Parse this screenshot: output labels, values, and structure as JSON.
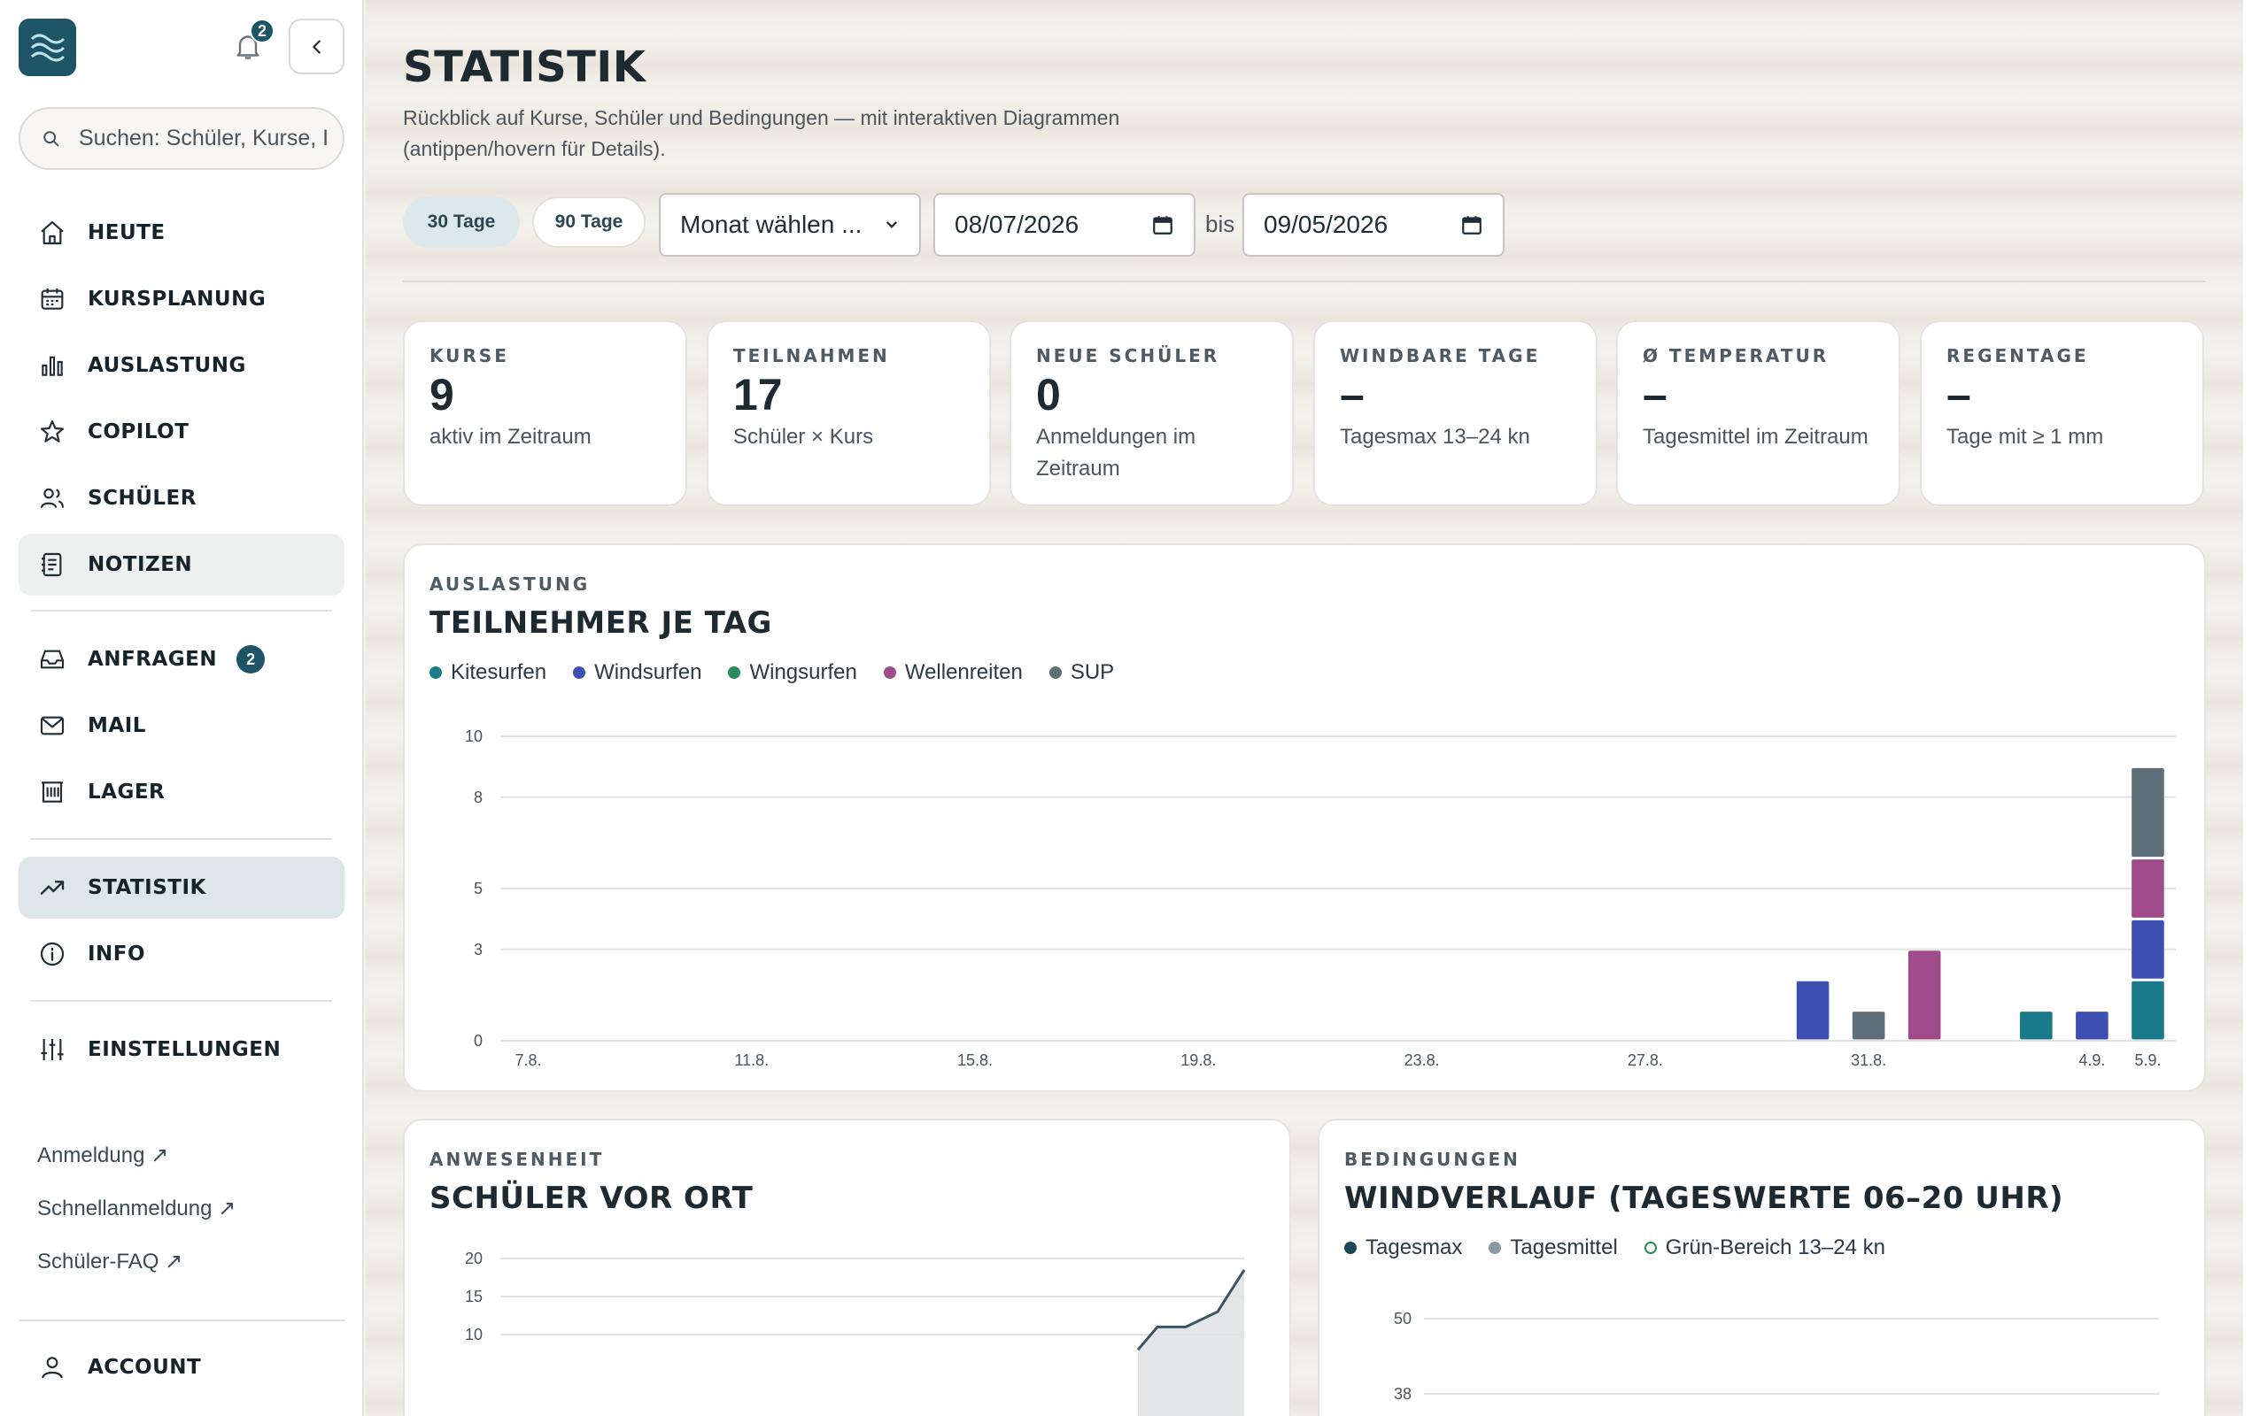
{
  "sidebar": {
    "notification_count": "2",
    "search_placeholder": "Suchen: Schüler, Kurse, I",
    "nav": [
      {
        "label": "HEUTE"
      },
      {
        "label": "KURSPLANUNG"
      },
      {
        "label": "AUSLASTUNG"
      },
      {
        "label": "COPILOT"
      },
      {
        "label": "SCHÜLER"
      },
      {
        "label": "NOTIZEN"
      },
      {
        "label": "ANFRAGEN",
        "badge": "2"
      },
      {
        "label": "MAIL"
      },
      {
        "label": "LAGER"
      },
      {
        "label": "STATISTIK"
      },
      {
        "label": "INFO"
      },
      {
        "label": "EINSTELLUNGEN"
      }
    ],
    "ext_links": [
      "Anmeldung ↗",
      "Schnellanmeldung ↗",
      "Schüler-FAQ ↗"
    ],
    "account_label": "ACCOUNT"
  },
  "header": {
    "title": "STATISTIK",
    "subtitle": "Rückblick auf Kurse, Schüler und Bedingungen — mit interaktiven Diagrammen (antippen/hovern für Details)."
  },
  "filters": {
    "chip_30": "30 Tage",
    "chip_90": "90 Tage",
    "month_select": "Monat wählen ...",
    "from_date": "08/07/2026",
    "bis": "bis",
    "to_date": "09/05/2026"
  },
  "stats": [
    {
      "key": "KURSE",
      "value": "9",
      "sub": "aktiv im Zeitraum"
    },
    {
      "key": "TEILNAHMEN",
      "value": "17",
      "sub": "Schüler × Kurs"
    },
    {
      "key": "NEUE SCHÜLER",
      "value": "0",
      "sub": "Anmeldungen im Zeitraum"
    },
    {
      "key": "WINDBARE TAGE",
      "value": "–",
      "sub": "Tagesmax 13–24 kn"
    },
    {
      "key": "Ø TEMPERATUR",
      "value": "–",
      "sub": "Tagesmittel im Zeitraum"
    },
    {
      "key": "REGENTAGE",
      "value": "–",
      "sub": "Tage mit ≥ 1 mm"
    }
  ],
  "panels": {
    "auslastung": {
      "kicker": "AUSLASTUNG",
      "title": "TEILNEHMER JE TAG"
    },
    "anwesenheit": {
      "kicker": "ANWESENHEIT",
      "title": "SCHÜLER VOR ORT"
    },
    "bedingungen": {
      "kicker": "BEDINGUNGEN",
      "title": "WINDVERLAUF (TAGESWERTE 06–20 UHR)"
    }
  },
  "chart_data": [
    {
      "type": "bar",
      "stacked": true,
      "legend_position": "top-left",
      "grid": true,
      "categories": [
        "7.8.",
        "8.8.",
        "9.8.",
        "10.8.",
        "11.8.",
        "12.8.",
        "13.8.",
        "14.8.",
        "15.8.",
        "16.8.",
        "17.8.",
        "18.8.",
        "19.8.",
        "20.8.",
        "21.8.",
        "22.8.",
        "23.8.",
        "24.8.",
        "25.8.",
        "26.8.",
        "27.8.",
        "28.8.",
        "29.8.",
        "30.8.",
        "31.8.",
        "1.9.",
        "2.9.",
        "3.9.",
        "4.9.",
        "5.9."
      ],
      "x_tick_labels": [
        "7.8.",
        "11.8.",
        "15.8.",
        "19.8.",
        "23.8.",
        "27.8.",
        "31.8.",
        "4.9.",
        "5.9."
      ],
      "y_ticks": [
        "0",
        "3",
        "5",
        "8",
        "10"
      ],
      "ylim": [
        0,
        10
      ],
      "series": [
        {
          "name": "Kitesurfen",
          "color": "#1a7a8c",
          "values": [
            0,
            0,
            0,
            0,
            0,
            0,
            0,
            0,
            0,
            0,
            0,
            0,
            0,
            0,
            0,
            0,
            0,
            0,
            0,
            0,
            0,
            0,
            0,
            0,
            0,
            0,
            0,
            1,
            0,
            2
          ]
        },
        {
          "name": "Windsurfen",
          "color": "#3d4fb0",
          "values": [
            0,
            0,
            0,
            0,
            0,
            0,
            0,
            0,
            0,
            0,
            0,
            0,
            0,
            0,
            0,
            0,
            0,
            0,
            0,
            0,
            0,
            0,
            0,
            2,
            0,
            0,
            0,
            0,
            1,
            2
          ]
        },
        {
          "name": "Wingsurfen",
          "color": "#2a8a5a",
          "values": [
            0,
            0,
            0,
            0,
            0,
            0,
            0,
            0,
            0,
            0,
            0,
            0,
            0,
            0,
            0,
            0,
            0,
            0,
            0,
            0,
            0,
            0,
            0,
            0,
            0,
            0,
            0,
            0,
            0,
            0
          ]
        },
        {
          "name": "Wellenreiten",
          "color": "#a04b8a",
          "values": [
            0,
            0,
            0,
            0,
            0,
            0,
            0,
            0,
            0,
            0,
            0,
            0,
            0,
            0,
            0,
            0,
            0,
            0,
            0,
            0,
            0,
            0,
            0,
            0,
            0,
            3,
            0,
            0,
            0,
            2
          ]
        },
        {
          "name": "SUP",
          "color": "#5f6f7a",
          "values": [
            0,
            0,
            0,
            0,
            0,
            0,
            0,
            0,
            0,
            0,
            0,
            0,
            0,
            0,
            0,
            0,
            0,
            0,
            0,
            0,
            0,
            0,
            0,
            0,
            1,
            0,
            0,
            0,
            0,
            3
          ]
        }
      ]
    },
    {
      "type": "area",
      "grid": true,
      "y_ticks": [
        "10",
        "15",
        "20"
      ],
      "ylim_visible": [
        10,
        20
      ],
      "series": [
        {
          "values": [
            8,
            11,
            11,
            13,
            18.5
          ]
        }
      ]
    },
    {
      "type": "line",
      "grid": true,
      "legend_position": "top-left",
      "legend": [
        {
          "name": "Tagesmax",
          "color": "#1d4756"
        },
        {
          "name": "Tagesmittel",
          "color": "#8a9aa3"
        },
        {
          "name": "Grün-Bereich 13–24 kn",
          "color": "#2a8a5a",
          "ring": true
        }
      ],
      "y_ticks": [
        "38",
        "50"
      ]
    }
  ]
}
